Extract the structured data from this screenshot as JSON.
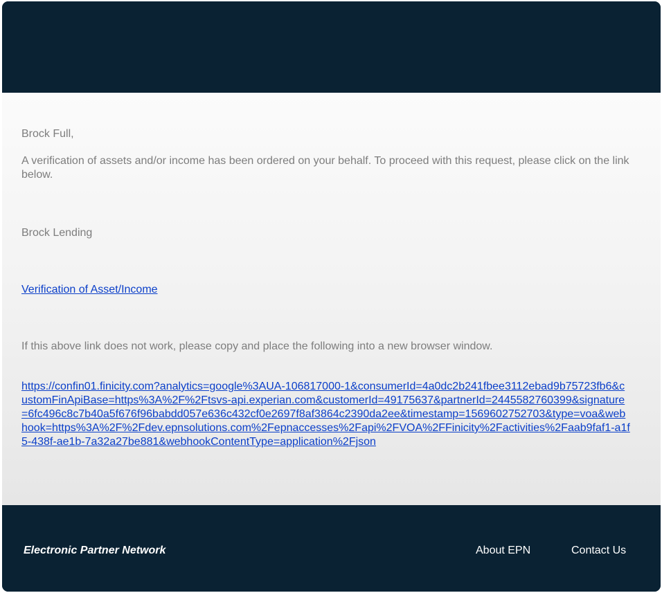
{
  "email": {
    "greeting": "Brock Full,",
    "message": "A verification of assets and/or income has been ordered on your behalf. To proceed with this request, please click on the link below.",
    "sender": "Brock Lending",
    "primary_link_label": "Verification of Asset/Income",
    "fallback_note": "If this above link does not work, please copy and place the following into a new browser window.",
    "fallback_url": "https://confin01.finicity.com?analytics=google%3AUA-106817000-1&consumerId=4a0dc2b241fbee3112ebad9b75723fb6&customFinApiBase=https%3A%2F%2Ftsvs-api.experian.com&customerId=49175637&partnerId=2445582760399&signature=6fc496c8c7b40a5f676f96babdd057e636c432cf0e2697f8af3864c2390da2ee&timestamp=1569602752703&type=voa&webhook=https%3A%2F%2Fdev.epnsolutions.com%2Fepnaccesses%2Fapi%2FVOA%2FFinicity%2Factivities%2Faab9faf1-a1f5-438f-ae1b-7a32a27be881&webhookContentType=application%2Fjson"
  },
  "footer": {
    "brand": "Electronic Partner Network",
    "about_label": "About EPN",
    "contact_label": "Contact Us"
  },
  "colors": {
    "dark_navy": "#0a2233",
    "body_text": "#7d7d7d",
    "link": "#0b3fc9"
  }
}
